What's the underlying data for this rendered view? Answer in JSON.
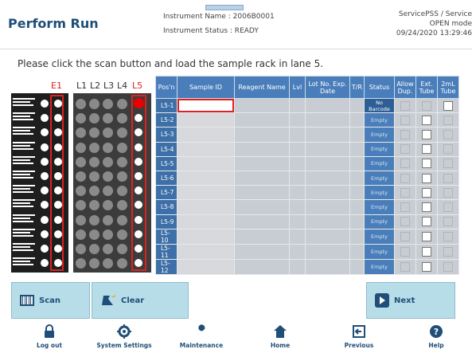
{
  "header": {
    "title": "Perform Run",
    "instrument_name": "Instrument Name : 2006B0001",
    "instrument_status": "Instrument Status : READY",
    "user": "ServicePSS / Service",
    "mode": "OPEN mode",
    "datetime": "09/24/2020 13:29:46"
  },
  "instruction": "Please click the scan button and load the sample rack in lane 5.",
  "rack": {
    "lanes": [
      "E1",
      "L1",
      "L2",
      "L3",
      "L4",
      "L5"
    ]
  },
  "table": {
    "columns": [
      "Pos'n",
      "Sample ID",
      "Reagent Name",
      "Lvl",
      "Lot No. Exp. Date",
      "T/R",
      "Status",
      "Allow Dup.",
      "Ext. Tube",
      "2mL Tube"
    ],
    "rows": [
      {
        "pos": "L5-1",
        "status": "No Barcode"
      },
      {
        "pos": "L5-2",
        "status": "Empty"
      },
      {
        "pos": "L5-3",
        "status": "Empty"
      },
      {
        "pos": "L5-4",
        "status": "Empty"
      },
      {
        "pos": "L5-5",
        "status": "Empty"
      },
      {
        "pos": "L5-6",
        "status": "Empty"
      },
      {
        "pos": "L5-7",
        "status": "Empty"
      },
      {
        "pos": "L5-8",
        "status": "Empty"
      },
      {
        "pos": "L5-9",
        "status": "Empty"
      },
      {
        "pos": "L5-10",
        "status": "Empty"
      },
      {
        "pos": "L5-11",
        "status": "Empty"
      },
      {
        "pos": "L5-12",
        "status": "Empty"
      }
    ]
  },
  "buttons": {
    "scan": "Scan",
    "clear": "Clear",
    "next": "Next"
  },
  "footer": {
    "logout": "Log out",
    "settings": "System Settings",
    "maintenance": "Maintenance",
    "home": "Home",
    "previous": "Previous",
    "help": "Help"
  },
  "colors": {
    "accent": "#1f4e79",
    "table_header": "#4a7ebb",
    "button": "#b7dde8",
    "highlight": "#e02020"
  },
  "icons": [
    "barcode-icon",
    "flask-icon",
    "arrow-right-icon",
    "lock-icon",
    "gear-icon",
    "wrench-icon",
    "home-icon",
    "previous-icon",
    "help-icon"
  ]
}
